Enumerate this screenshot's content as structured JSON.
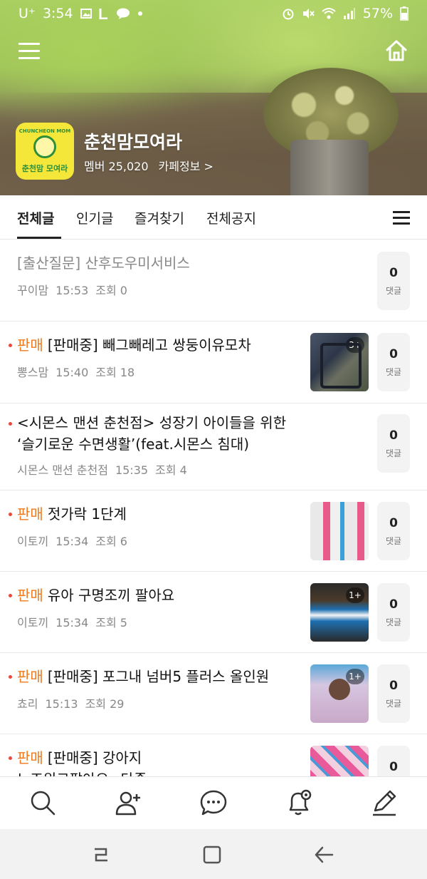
{
  "status_bar": {
    "carrier": "U⁺",
    "time": "3:54",
    "battery": "57%",
    "left_icons": [
      "gallery-icon",
      "line-icon",
      "kakaotalk-icon",
      "dot-icon"
    ],
    "right_icons": [
      "alarm-icon",
      "mute-icon",
      "wifi-icon",
      "signal-icon",
      "battery-icon"
    ]
  },
  "cafe": {
    "name": "춘천맘모여라",
    "members": "멤버 25,020",
    "info_link": "카페정보 >",
    "logo": {
      "top_text": "CHUNCHEON MOM",
      "bottom_text": "춘천맘 모여라"
    }
  },
  "tabs": [
    {
      "label": "전체글",
      "active": true
    },
    {
      "label": "인기글",
      "active": false
    },
    {
      "label": "즐겨찾기",
      "active": false
    },
    {
      "label": "전체공지",
      "active": false
    }
  ],
  "posts": [
    {
      "tag": "",
      "title_lines": [
        "[출산질문] 산후도우미서비스"
      ],
      "author": "꾸이맘",
      "time": "15:53",
      "views": "조회 0",
      "comments": "0",
      "comments_label": "댓글",
      "read": true,
      "new_dot": false,
      "thumb": null
    },
    {
      "tag": "판매",
      "title_lines": [
        "[판매중] 빼그빼레고 쌍둥이유모차"
      ],
      "author": "뽕스맘",
      "time": "15:40",
      "views": "조회 18",
      "comments": "0",
      "comments_label": "댓글",
      "read": false,
      "new_dot": true,
      "thumb": {
        "kind": "stroller",
        "count": "3+"
      }
    },
    {
      "tag": "",
      "title_lines": [
        "<시몬스 맨션 춘천점> 성장기 아이들을 위한",
        "‘슬기로운 수면생활’(feat.시몬스 침대)"
      ],
      "author": "시몬스 맨션 춘천점",
      "time": "15:35",
      "views": "조회 4",
      "comments": "0",
      "comments_label": "댓글",
      "read": false,
      "new_dot": true,
      "thumb": null
    },
    {
      "tag": "판매",
      "title_lines": [
        "젓가락 1단계"
      ],
      "author": "이토끼",
      "time": "15:34",
      "views": "조회 6",
      "comments": "0",
      "comments_label": "댓글",
      "read": false,
      "new_dot": true,
      "thumb": {
        "kind": "chopsticks",
        "count": ""
      }
    },
    {
      "tag": "판매",
      "title_lines": [
        "유아 구명조끼 팔아요"
      ],
      "author": "이토끼",
      "time": "15:34",
      "views": "조회 5",
      "comments": "0",
      "comments_label": "댓글",
      "read": false,
      "new_dot": true,
      "thumb": {
        "kind": "vest",
        "count": "1+"
      }
    },
    {
      "tag": "판매",
      "title_lines": [
        "[판매중] 포그내 넘버5 플러스 올인원"
      ],
      "author": "쵸리",
      "time": "15:13",
      "views": "조회 29",
      "comments": "0",
      "comments_label": "댓글",
      "read": false,
      "new_dot": true,
      "thumb": {
        "kind": "carrier",
        "count": "1+"
      }
    },
    {
      "tag": "판매",
      "title_lines": [
        "[판매중] 강아지",
        "노즈워크팔아요~단종"
      ],
      "author": "",
      "time": "",
      "views": "",
      "comments": "0",
      "comments_label": "",
      "read": false,
      "new_dot": true,
      "thumb": {
        "kind": "blanket",
        "count": ""
      }
    }
  ],
  "bottom_nav": [
    {
      "name": "search",
      "icon": "search-icon"
    },
    {
      "name": "invite-member",
      "icon": "add-person-icon"
    },
    {
      "name": "chat",
      "icon": "chat-bubble-icon"
    },
    {
      "name": "notification-settings",
      "icon": "bell-gear-icon"
    },
    {
      "name": "write",
      "icon": "pencil-icon"
    }
  ],
  "system_nav": [
    "recent-apps-icon",
    "home-square-icon",
    "back-arrow-icon"
  ],
  "colors": {
    "sale_tag": "#f07a1f",
    "new_dot": "#e84a3a",
    "logo_bg": "#f5e63a"
  }
}
